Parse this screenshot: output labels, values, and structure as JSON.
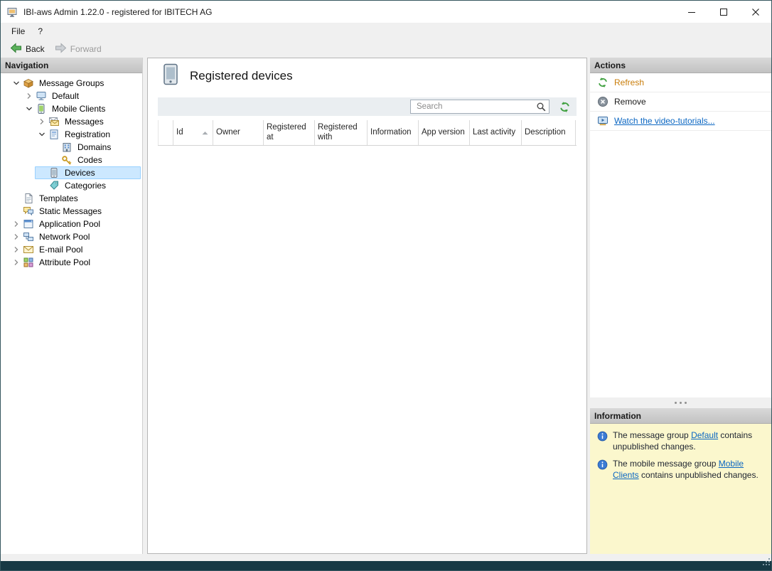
{
  "window": {
    "title": "IBI-aws Admin 1.22.0 - registered for IBITECH AG"
  },
  "menubar": {
    "items": [
      "File",
      "?"
    ]
  },
  "toolbar": {
    "back": "Back",
    "forward": "Forward"
  },
  "navigation": {
    "header": "Navigation",
    "tree": [
      {
        "label": "Message Groups",
        "state": "expanded"
      },
      {
        "label": "Default",
        "state": "collapsed"
      },
      {
        "label": "Mobile Clients",
        "state": "expanded"
      },
      {
        "label": "Messages",
        "state": "collapsed"
      },
      {
        "label": "Registration",
        "state": "expanded"
      },
      {
        "label": "Domains",
        "state": "leaf"
      },
      {
        "label": "Codes",
        "state": "leaf"
      },
      {
        "label": "Devices",
        "state": "leaf",
        "selected": true
      },
      {
        "label": "Categories",
        "state": "leaf"
      },
      {
        "label": "Templates",
        "state": "leaf"
      },
      {
        "label": "Static Messages",
        "state": "leaf"
      },
      {
        "label": "Application Pool",
        "state": "collapsed"
      },
      {
        "label": "Network Pool",
        "state": "collapsed"
      },
      {
        "label": "E-mail Pool",
        "state": "collapsed"
      },
      {
        "label": "Attribute Pool",
        "state": "collapsed"
      }
    ]
  },
  "content": {
    "title": "Registered devices",
    "search_placeholder": "Search",
    "table": {
      "columns": [
        "Id",
        "Owner",
        "Registered at",
        "Registered with",
        "Information",
        "App version",
        "Last activity",
        "Description"
      ],
      "sorted_column": "Id",
      "sort_direction": "ascending",
      "rows": []
    }
  },
  "actions": {
    "header": "Actions",
    "refresh": "Refresh",
    "remove": "Remove",
    "tutorials": "Watch the video-tutorials..."
  },
  "information": {
    "header": "Information",
    "notes": [
      {
        "prefix": "The message group ",
        "link": "Default",
        "suffix": " contains unpublished changes."
      },
      {
        "prefix": "The mobile message group ",
        "link": "Mobile Clients",
        "suffix": " contains unpublished changes."
      }
    ]
  },
  "colors": {
    "selection_bg": "#cce8ff",
    "selection_border": "#99d1ff",
    "link": "#0a66c2",
    "refresh_action": "#c97d0a",
    "info_bg": "#fbf7cd",
    "statusbar": "#173945"
  }
}
